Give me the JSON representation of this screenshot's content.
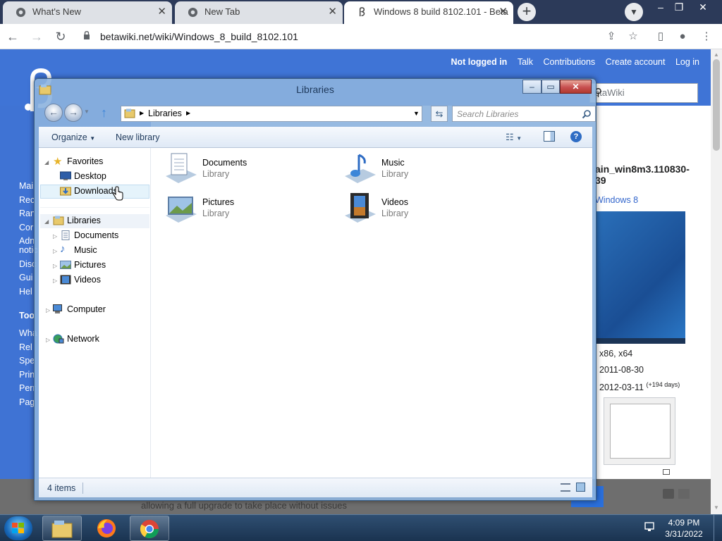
{
  "browser": {
    "tabs": [
      {
        "title": "What's New"
      },
      {
        "title": "New Tab"
      },
      {
        "title": "Windows 8 build 8102.101 - Beta"
      }
    ],
    "url": "betawiki.net/wiki/Windows_8_build_8102.101"
  },
  "wiki": {
    "top_links": [
      "Not logged in",
      "Talk",
      "Contributions",
      "Create account",
      "Log in"
    ],
    "search_placeholder": "etaWiki",
    "sidebar_links_1": [
      "Mai",
      "Rec",
      "Ran",
      "Cor",
      "Adn",
      "notic",
      "Disc",
      "Gui",
      "Hel"
    ],
    "sidebar_heading": "Too",
    "sidebar_links_2": [
      "Wha",
      "Rel",
      "Spe",
      "Prin",
      "Perr",
      "Pag"
    ],
    "infobox_title_1": "ain_win8m3.110830-",
    "infobox_title_2": "39",
    "infobox_sub": "Windows 8",
    "arch": "x86, x64",
    "compiled": "2011-08-30",
    "released": "2012-03-11",
    "released_days": "(+194 days)",
    "footer_text": "allowing a full upgrade to take place without issues"
  },
  "explorer": {
    "title": "Libraries",
    "address": "Libraries",
    "search_placeholder": "Search Libraries",
    "commands": {
      "organize": "Organize",
      "new_library": "New library"
    },
    "nav": {
      "favorites": "Favorites",
      "desktop": "Desktop",
      "downloads": "Downloads",
      "libraries": "Libraries",
      "documents": "Documents",
      "music": "Music",
      "pictures": "Pictures",
      "videos": "Videos",
      "computer": "Computer",
      "network": "Network"
    },
    "items": [
      {
        "name": "Documents",
        "type": "Library"
      },
      {
        "name": "Music",
        "type": "Library"
      },
      {
        "name": "Pictures",
        "type": "Library"
      },
      {
        "name": "Videos",
        "type": "Library"
      }
    ],
    "status": "4 items"
  },
  "taskbar": {
    "time": "4:09 PM",
    "date": "3/31/2022"
  }
}
